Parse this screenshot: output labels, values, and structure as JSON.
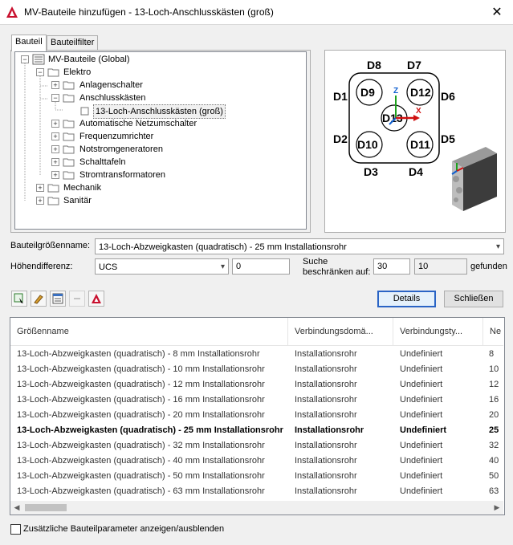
{
  "window": {
    "title": "MV-Bauteile hinzufügen - 13-Loch-Anschlusskästen (groß)",
    "close_label": "✕"
  },
  "tabs": [
    {
      "label": "Bauteil"
    },
    {
      "label": "Bauteilfilter"
    }
  ],
  "tree": {
    "items": [
      {
        "label": "MV-Bauteile (Global)"
      },
      {
        "label": "Elektro"
      },
      {
        "label": "Anlagenschalter"
      },
      {
        "label": "Anschlusskästen"
      },
      {
        "label": "13-Loch-Anschlusskästen (groß)"
      },
      {
        "label": "Automatische Netzumschalter"
      },
      {
        "label": "Frequenzumrichter"
      },
      {
        "label": "Notstromgeneratoren"
      },
      {
        "label": "Schalttafeln"
      },
      {
        "label": "Stromtransformatoren"
      },
      {
        "label": "Mechanik"
      },
      {
        "label": "Sanitär"
      }
    ]
  },
  "preview": {
    "labels": {
      "D1": "D1",
      "D2": "D2",
      "D3": "D3",
      "D4": "D4",
      "D5": "D5",
      "D6": "D6",
      "D7": "D7",
      "D8": "D8",
      "D9": "D9",
      "D10": "D10",
      "D11": "D11",
      "D12": "D12",
      "D13": "D13"
    },
    "axis_z": "Z",
    "axis_x": "X"
  },
  "form": {
    "size_label": "Bauteilgrößenname:",
    "size_value": "13-Loch-Abzweigkasten (quadratisch) - 25 mm Installationsrohr",
    "height_label": "Höhendifferenz:",
    "height_combo_value": "UCS",
    "height_input_value": "0",
    "search_label_line1": "Suche",
    "search_label_line2": "beschränken auf:",
    "search_limit_value": "30",
    "found_count_value": "10",
    "found_label": "gefunden"
  },
  "buttons": {
    "details": "Details",
    "close": "Schließen"
  },
  "table": {
    "columns": [
      "Größenname",
      "Verbindungsdomä...",
      "Verbindungsty...",
      "Ne"
    ],
    "rows": [
      [
        "13-Loch-Abzweigkasten (quadratisch) - 8 mm Installationsrohr",
        "Installationsrohr",
        "Undefiniert",
        "8"
      ],
      [
        "13-Loch-Abzweigkasten (quadratisch) - 10 mm Installationsrohr",
        "Installationsrohr",
        "Undefiniert",
        "10"
      ],
      [
        "13-Loch-Abzweigkasten (quadratisch) - 12 mm Installationsrohr",
        "Installationsrohr",
        "Undefiniert",
        "12"
      ],
      [
        "13-Loch-Abzweigkasten (quadratisch) - 16 mm Installationsrohr",
        "Installationsrohr",
        "Undefiniert",
        "16"
      ],
      [
        "13-Loch-Abzweigkasten (quadratisch) - 20 mm Installationsrohr",
        "Installationsrohr",
        "Undefiniert",
        "20"
      ],
      [
        "13-Loch-Abzweigkasten (quadratisch) - 25 mm Installationsrohr",
        "Installationsrohr",
        "Undefiniert",
        "25"
      ],
      [
        "13-Loch-Abzweigkasten (quadratisch) - 32 mm Installationsrohr",
        "Installationsrohr",
        "Undefiniert",
        "32"
      ],
      [
        "13-Loch-Abzweigkasten (quadratisch) - 40 mm Installationsrohr",
        "Installationsrohr",
        "Undefiniert",
        "40"
      ],
      [
        "13-Loch-Abzweigkasten (quadratisch) - 50 mm Installationsrohr",
        "Installationsrohr",
        "Undefiniert",
        "50"
      ],
      [
        "13-Loch-Abzweigkasten (quadratisch) - 63 mm Installationsrohr",
        "Installationsrohr",
        "Undefiniert",
        "63"
      ]
    ],
    "selected_row_index": 5
  },
  "footer": {
    "checkbox_label": "Zusätzliche Bauteilparameter anzeigen/ausblenden"
  },
  "colors": {
    "accent": "#2a64c5",
    "app_icon": "#c8102e"
  }
}
